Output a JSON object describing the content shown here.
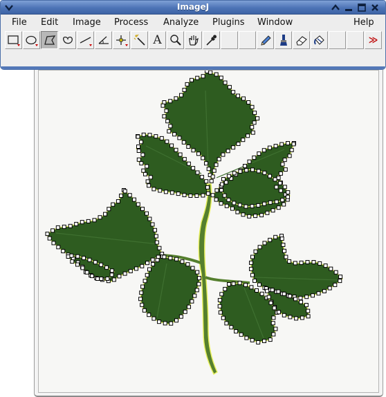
{
  "window": {
    "title": "ImageJ"
  },
  "menubar": {
    "items": [
      {
        "id": "file",
        "label": "File"
      },
      {
        "id": "edit",
        "label": "Edit"
      },
      {
        "id": "image",
        "label": "Image"
      },
      {
        "id": "process",
        "label": "Process"
      },
      {
        "id": "analyze",
        "label": "Analyze"
      },
      {
        "id": "plugins",
        "label": "Plugins"
      },
      {
        "id": "window",
        "label": "Window"
      },
      {
        "id": "help",
        "label": "Help"
      }
    ]
  },
  "toolbar": {
    "tools": [
      {
        "name": "rectangle-tool-icon",
        "selected": false
      },
      {
        "name": "oval-tool-icon",
        "selected": false
      },
      {
        "name": "polygon-tool-icon",
        "selected": true
      },
      {
        "name": "freehand-tool-icon",
        "selected": false
      },
      {
        "name": "line-tool-icon",
        "selected": false
      },
      {
        "name": "angle-tool-icon",
        "selected": false
      },
      {
        "name": "point-tool-icon",
        "selected": false
      },
      {
        "name": "wand-tool-icon",
        "selected": false
      },
      {
        "name": "text-tool-icon",
        "selected": false
      },
      {
        "name": "magnifier-tool-icon",
        "selected": false
      },
      {
        "name": "hand-tool-icon",
        "selected": false
      },
      {
        "name": "color-picker-tool-icon",
        "selected": false
      },
      {
        "name": "empty-slot",
        "selected": false
      },
      {
        "name": "empty-slot",
        "selected": false
      },
      {
        "name": "pencil-tool-icon",
        "selected": false
      },
      {
        "name": "brush-tool-icon",
        "selected": false
      },
      {
        "name": "eraser-tool-icon",
        "selected": false
      },
      {
        "name": "flood-fill-tool-icon",
        "selected": false
      },
      {
        "name": "empty-slot",
        "selected": false
      },
      {
        "name": "empty-slot",
        "selected": false
      },
      {
        "name": "more-tools-icon",
        "selected": false
      }
    ],
    "text_tool_glyph": "A",
    "more_tools_glyph": "≫"
  },
  "statusbar": {
    "text": ""
  },
  "image": {
    "subject": "leaf-image",
    "roi_color": "#e8f060",
    "leaf_color": "#2f5e22",
    "stem_color": "#4f7d2c"
  }
}
